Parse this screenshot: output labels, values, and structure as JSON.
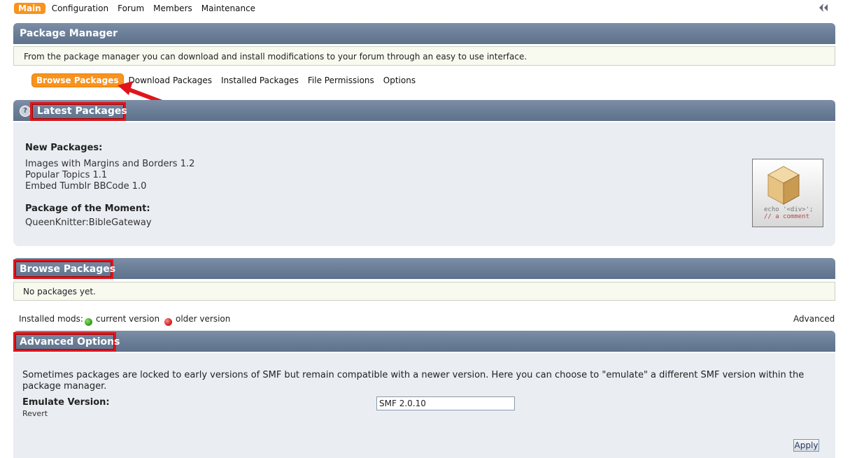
{
  "topnav": {
    "items": [
      "Main",
      "Configuration",
      "Forum",
      "Members",
      "Maintenance"
    ],
    "active": "Main"
  },
  "package_manager": {
    "title": "Package Manager",
    "description": "From the package manager you can download and install modifications to your forum through an easy to use interface."
  },
  "subtabs": [
    "Browse Packages",
    "Download Packages",
    "Installed Packages",
    "File Permissions",
    "Options"
  ],
  "latest": {
    "title": "Latest Packages",
    "help_icon": "?",
    "new_heading": "New Packages:",
    "new_items": [
      "Images with Margins and Borders 1.2",
      "Popular Topics 1.1",
      "Embed Tumblr BBCode 1.0"
    ],
    "moment_heading": "Package of the Moment:",
    "moment_item": "QueenKnitter:BibleGateway",
    "image_text_1": "echo '<div>';",
    "image_text_2": "// a comment"
  },
  "browse": {
    "title": "Browse Packages",
    "empty_text": "No packages yet."
  },
  "legend": {
    "label": "Installed mods:",
    "current": "current version",
    "older": "older version",
    "advanced_link": "Advanced",
    "current_color": "#3aa21d",
    "older_color": "#d42424"
  },
  "advanced": {
    "title": "Advanced Options",
    "text": "Sometimes packages are locked to early versions of SMF but remain compatible with a newer version. Here you can choose to \"emulate\" a different SMF version within the package manager.",
    "emulate_label": "Emulate Version:",
    "revert": "Revert",
    "emulate_value": "SMF 2.0.10",
    "apply": "Apply"
  },
  "colors": {
    "accent": "#f7931e",
    "catbar": "#6a7d97",
    "highlight": "#e0151b"
  }
}
